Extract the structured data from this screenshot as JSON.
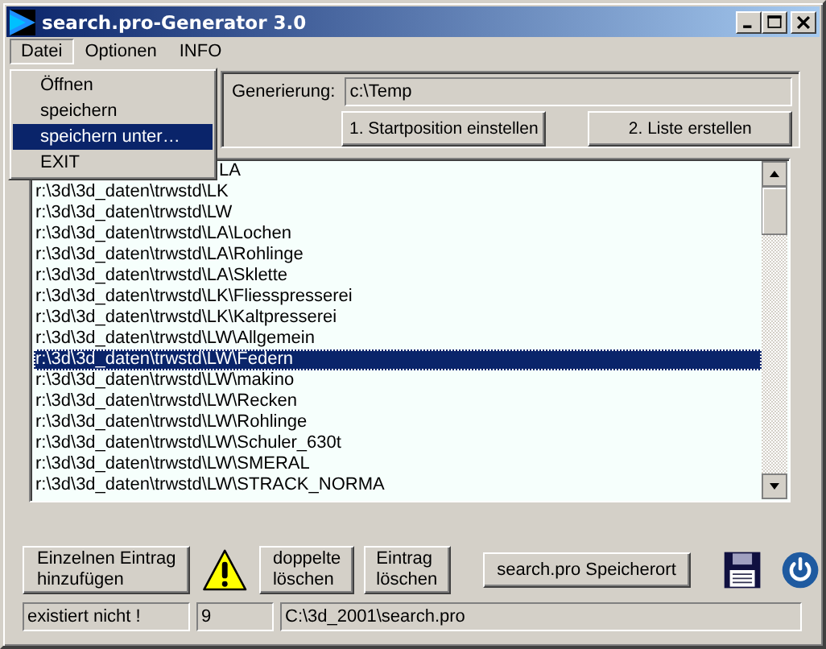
{
  "window": {
    "title": "search.pro-Generator 3.0"
  },
  "menu_bar": [
    {
      "label": "Datei",
      "selected": true
    },
    {
      "label": "Optionen",
      "selected": false
    },
    {
      "label": "INFO",
      "selected": false
    }
  ],
  "menu": {
    "items": [
      {
        "label": "Öffnen",
        "selected": false
      },
      {
        "label": "speichern",
        "selected": false
      },
      {
        "label": "speichern unter…",
        "selected": true
      },
      {
        "label": "EXIT",
        "selected": false
      }
    ]
  },
  "generation": {
    "label": "Generierung:",
    "value": "c:\\Temp",
    "buttons": [
      "1. Startposition einstellen",
      "2. Liste erstellen"
    ]
  },
  "list": {
    "rows": [
      {
        "text": "LA",
        "selected": false,
        "kind": "covered"
      },
      {
        "text": "r:\\3d\\3d_daten\\trwstd\\LK",
        "selected": false
      },
      {
        "text": "r:\\3d\\3d_daten\\trwstd\\LW",
        "selected": false
      },
      {
        "text": "r:\\3d\\3d_daten\\trwstd\\LA\\Lochen",
        "selected": false
      },
      {
        "text": "r:\\3d\\3d_daten\\trwstd\\LA\\Rohlinge",
        "selected": false
      },
      {
        "text": "r:\\3d\\3d_daten\\trwstd\\LA\\Sklette",
        "selected": false
      },
      {
        "text": "r:\\3d\\3d_daten\\trwstd\\LK\\Fliesspresserei",
        "selected": false
      },
      {
        "text": "r:\\3d\\3d_daten\\trwstd\\LK\\Kaltpresserei",
        "selected": false
      },
      {
        "text": "r:\\3d\\3d_daten\\trwstd\\LW\\Allgemein",
        "selected": false
      },
      {
        "text": "r:\\3d\\3d_daten\\trwstd\\LW\\Federn",
        "selected": true
      },
      {
        "text": "r:\\3d\\3d_daten\\trwstd\\LW\\makino",
        "selected": false
      },
      {
        "text": "r:\\3d\\3d_daten\\trwstd\\LW\\Recken",
        "selected": false
      },
      {
        "text": "r:\\3d\\3d_daten\\trwstd\\LW\\Rohlinge",
        "selected": false
      },
      {
        "text": "r:\\3d\\3d_daten\\trwstd\\LW\\Schuler_630t",
        "selected": false
      },
      {
        "text": "r:\\3d\\3d_daten\\trwstd\\LW\\SMERAL",
        "selected": false
      },
      {
        "text": "r:\\3d\\3d_daten\\trwstd\\LW\\STRACK_NORMA",
        "selected": false
      }
    ]
  },
  "toolbar": [
    {
      "kind": "button",
      "label": "Einzelnen Eintrag\nhinzufügen"
    },
    {
      "kind": "warning"
    },
    {
      "kind": "button",
      "label": "doppelte\nlöschen"
    },
    {
      "kind": "button",
      "label": "Eintrag\nlöschen"
    },
    {
      "kind": "button",
      "label": "search.pro Speicherort"
    },
    {
      "kind": "save"
    },
    {
      "kind": "power"
    }
  ],
  "status_bar": [
    "existiert nicht !",
    "9",
    "C:\\3d_2001\\search.pro"
  ]
}
